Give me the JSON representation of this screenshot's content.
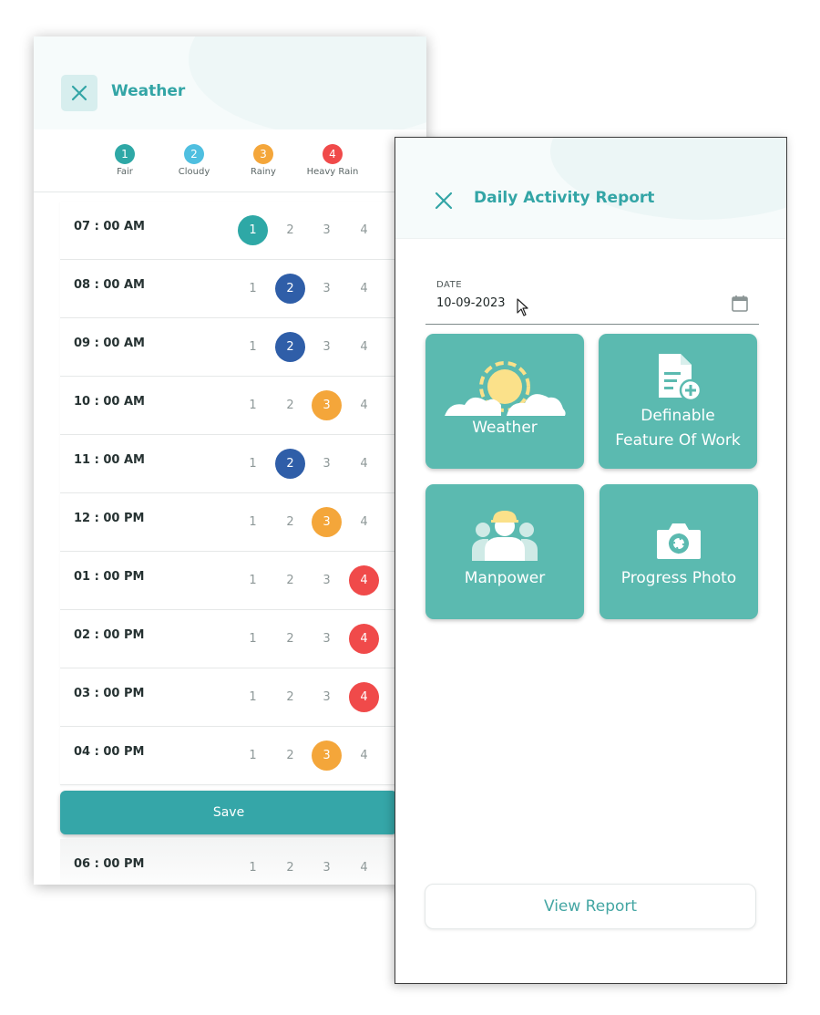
{
  "weather": {
    "title": "Weather",
    "legend": [
      {
        "num": "1",
        "label": "Fair",
        "color": "#2ea8a6"
      },
      {
        "num": "2",
        "label": "Cloudy",
        "color": "#4fbfe0"
      },
      {
        "num": "3",
        "label": "Rainy",
        "color": "#f4a63a"
      },
      {
        "num": "4",
        "label": "Heavy Rain",
        "color": "#f04a4a"
      }
    ],
    "options": [
      "1",
      "2",
      "3",
      "4"
    ],
    "rows": [
      {
        "time": "07 : 00 AM",
        "selected": 1
      },
      {
        "time": "08 : 00 AM",
        "selected": 2
      },
      {
        "time": "09 : 00 AM",
        "selected": 2
      },
      {
        "time": "10 : 00 AM",
        "selected": 3
      },
      {
        "time": "11 : 00 AM",
        "selected": 2
      },
      {
        "time": "12 : 00 PM",
        "selected": 3
      },
      {
        "time": "01 : 00 PM",
        "selected": 4
      },
      {
        "time": "02 : 00 PM",
        "selected": 4
      },
      {
        "time": "03 : 00 PM",
        "selected": 4
      },
      {
        "time": "04 : 00 PM",
        "selected": 3
      }
    ],
    "selected_colors": {
      "1": "#2ea8a6",
      "2": "#2f5ea8",
      "3": "#f4a63a",
      "4": "#f04a4a"
    },
    "save_label": "Save",
    "last_row": {
      "time": "06 : 00 PM",
      "selected": 0
    }
  },
  "report": {
    "title": "Daily Activity Report",
    "date_label": "DATE",
    "date_value": "10-09-2023",
    "tiles": {
      "weather": "Weather",
      "dfow_line1": "Definable",
      "dfow_line2": "Feature Of Work",
      "manpower": "Manpower",
      "progress_photo": "Progress Photo"
    },
    "view_report_label": "View Report"
  },
  "colors": {
    "accent": "#33a5a6",
    "tile": "#5bbab0"
  }
}
